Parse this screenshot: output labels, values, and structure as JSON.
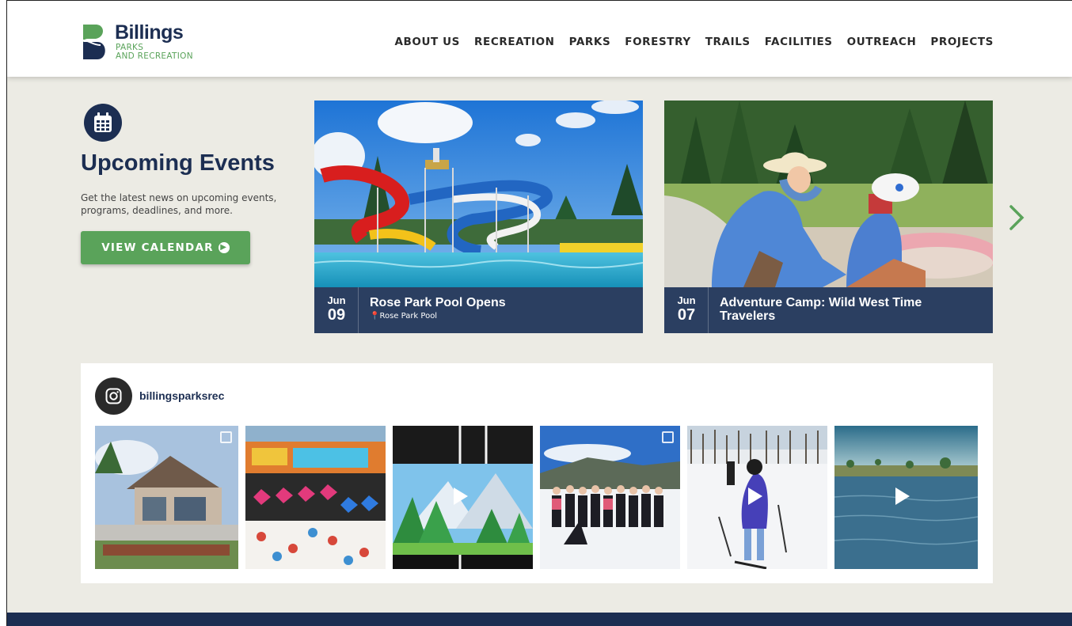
{
  "logo": {
    "title": "Billings",
    "subtitle_line1": "PARKS",
    "subtitle_line2": "AND RECREATION"
  },
  "nav": {
    "items": [
      "ABOUT US",
      "RECREATION",
      "PARKS",
      "FORESTRY",
      "TRAILS",
      "FACILITIES",
      "OUTREACH",
      "PROJECTS"
    ]
  },
  "events": {
    "icon": "calendar-icon",
    "title": "Upcoming Events",
    "description": "Get the latest news on upcoming events, programs, deadlines, and more.",
    "button_label": "VIEW CALENDAR",
    "cards": [
      {
        "month": "Jun",
        "day": "09",
        "title": "Rose Park Pool Opens",
        "location": "Rose Park Pool"
      },
      {
        "month": "Jun",
        "day": "07",
        "title": "Adventure Camp: Wild West Time Travelers",
        "location": ""
      }
    ],
    "next_icon": "chevron-right-icon"
  },
  "instagram": {
    "icon": "instagram-icon",
    "handle": "billingsparksrec",
    "tiles": [
      {
        "type": "carousel"
      },
      {
        "type": "image"
      },
      {
        "type": "video"
      },
      {
        "type": "carousel"
      },
      {
        "type": "video"
      },
      {
        "type": "video"
      }
    ]
  },
  "colors": {
    "navy": "#1c2e52",
    "green": "#5aa35a",
    "page_bg": "#ecebe4",
    "caption_bg": "#2b3f61"
  }
}
